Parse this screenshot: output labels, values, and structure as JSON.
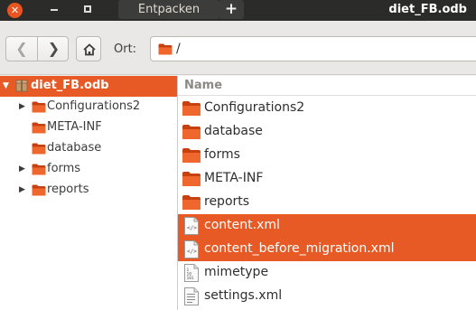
{
  "titlebar": {
    "close_glyph": "✕",
    "tab_label": "Entpacken",
    "new_tab_glyph": "+",
    "window_title": "diet_FB.odb"
  },
  "toolbar": {
    "back_glyph": "❮",
    "forward_glyph": "❯",
    "home_icon": "home-icon",
    "location_label": "Ort:",
    "path_text": "/"
  },
  "sidebar": {
    "root": {
      "label": "diet_FB.odb",
      "arrow": "▼"
    },
    "items": [
      {
        "label": "Configurations2",
        "arrow": "▶"
      },
      {
        "label": "META-INF",
        "arrow": ""
      },
      {
        "label": "database",
        "arrow": ""
      },
      {
        "label": "forms",
        "arrow": "▶"
      },
      {
        "label": "reports",
        "arrow": "▶"
      }
    ]
  },
  "pane": {
    "column_name": "Name",
    "files": [
      {
        "label": "Configurations2",
        "icon": "folder-icon"
      },
      {
        "label": "database",
        "icon": "folder-icon"
      },
      {
        "label": "forms",
        "icon": "folder-icon"
      },
      {
        "label": "META-INF",
        "icon": "folder-icon"
      },
      {
        "label": "reports",
        "icon": "folder-icon"
      },
      {
        "label": "content.xml",
        "icon": "xml-file-icon"
      },
      {
        "label": "content_before_migration.xml",
        "icon": "xml-file-icon"
      },
      {
        "label": "mimetype",
        "icon": "binary-file-icon"
      },
      {
        "label": "settings.xml",
        "icon": "text-file-icon"
      }
    ]
  },
  "colors": {
    "accent": "#e75a25",
    "titlebar": "#2b2b29",
    "folder": "#e95420"
  }
}
